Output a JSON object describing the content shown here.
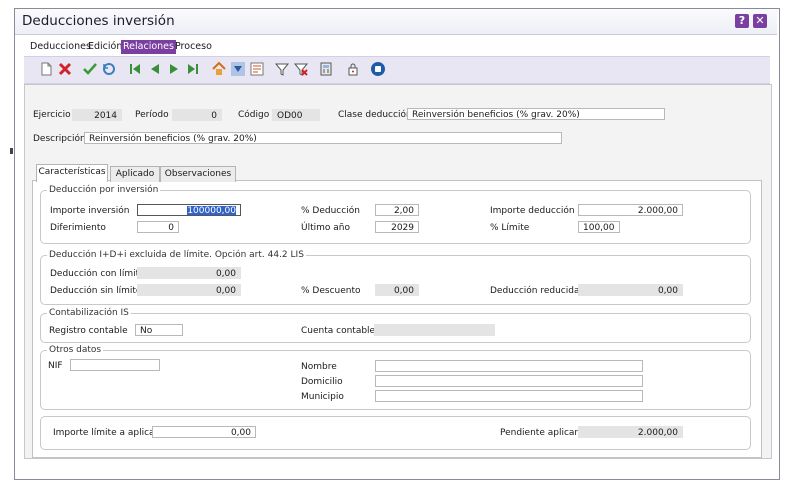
{
  "window": {
    "title": "Deducciones inversión"
  },
  "titlebar_buttons": {
    "help": "?",
    "close": "✕"
  },
  "menu": [
    "Deducciones",
    "Edición",
    "Relaciones",
    "Proceso"
  ],
  "header": {
    "ejercicio": {
      "label": "Ejercicio",
      "value": "2014"
    },
    "periodo": {
      "label": "Período",
      "value": "0"
    },
    "codigo": {
      "label": "Código",
      "value": "OD00"
    },
    "clase": {
      "label": "Clase deducción",
      "value": "Reinversión beneficios (% grav. 20%)"
    },
    "descripcion": {
      "label": "Descripción",
      "value": "Reinversión beneficios (% grav. 20%)"
    }
  },
  "tabs": [
    "Características",
    "Aplicado",
    "Observaciones"
  ],
  "deduccion_inversion": {
    "title": "Deducción por inversión",
    "importe_inversion": {
      "label": "Importe inversión",
      "value": "100000,00"
    },
    "diferimiento": {
      "label": "Diferimiento",
      "value": "0"
    },
    "pct_deduccion": {
      "label": "% Deducción",
      "value": "2,00"
    },
    "ultimo_anio": {
      "label": "Último año",
      "value": "2029"
    },
    "importe_deduccion": {
      "label": "Importe deducción",
      "value": "2.000,00"
    },
    "pct_limite": {
      "label": "% Límite",
      "value": "100,00"
    }
  },
  "excluida": {
    "title": "Deducción I+D+i excluida de límite. Opción art. 44.2 LIS",
    "con_limite": {
      "label": "Deducción con límite",
      "value": "0,00"
    },
    "sin_limite": {
      "label": "Deducción sin límite",
      "value": "0,00"
    },
    "pct_descuento": {
      "label": "% Descuento",
      "value": "0,00"
    },
    "reducida": {
      "label": "Deducción reducida",
      "value": "0,00"
    }
  },
  "contabilizacion": {
    "title": "Contabilización IS",
    "registro": {
      "label": "Registro contable",
      "value": "No"
    },
    "cuenta": {
      "label": "Cuenta contable",
      "value": ""
    }
  },
  "otros": {
    "title": "Otros datos",
    "nif": {
      "label": "NIF",
      "value": ""
    },
    "nombre": {
      "label": "Nombre",
      "value": ""
    },
    "domicilio": {
      "label": "Domicilio",
      "value": ""
    },
    "municipio": {
      "label": "Municipio",
      "value": ""
    }
  },
  "footer": {
    "importe_limite": {
      "label": "Importe límite a aplicar",
      "value": "0,00"
    },
    "pendiente": {
      "label": "Pendiente aplicar",
      "value": "2.000,00"
    }
  },
  "toolbar_icons": [
    "new-document-icon",
    "delete-icon",
    "confirm-check-icon",
    "undo-icon",
    "first-record-icon",
    "previous-record-icon",
    "next-record-icon",
    "last-record-icon",
    "home-icon",
    "filter-down-icon",
    "properties-icon",
    "filter-icon",
    "clear-filter-icon",
    "calculator-icon",
    "lock-icon",
    "info-icon"
  ],
  "colors": {
    "accent": "#7a3fa0",
    "toolbar_bg": "#e9e6f3",
    "selection": "#3264c8"
  }
}
